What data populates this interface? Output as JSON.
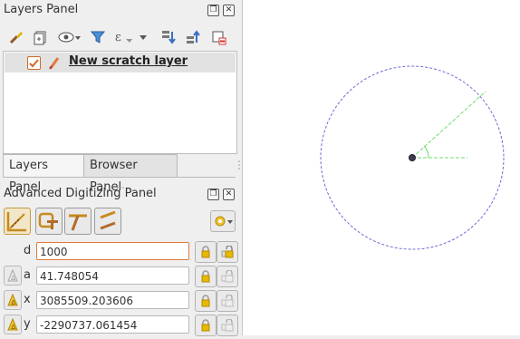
{
  "layers_panel": {
    "title": "Layers Panel",
    "float_icon": "float-icon",
    "close_icon": "close-icon",
    "toolbar": [
      {
        "name": "style-brush-icon"
      },
      {
        "name": "add-group-icon"
      },
      {
        "name": "eye-visibility-icon"
      },
      {
        "name": "filter-icon"
      },
      {
        "name": "expression-filter-icon"
      },
      {
        "name": "dropdown-arrow-icon"
      },
      {
        "name": "expand-all-icon"
      },
      {
        "name": "collapse-all-icon"
      },
      {
        "name": "remove-layer-icon"
      }
    ],
    "layers": [
      {
        "label": "New scratch layer",
        "checked": true,
        "icon": "edit-pencil-icon"
      }
    ]
  },
  "tabs": {
    "layers_panel_label": "Layers Panel",
    "browser_panel_label": "Browser Panel"
  },
  "advanced_digitizing": {
    "title": "Advanced Digitizing Panel",
    "tools": [
      {
        "name": "enable-advanced-digitizing-icon",
        "active": true
      },
      {
        "name": "construction-mode-icon",
        "active": false
      },
      {
        "name": "perpendicular-icon",
        "active": false
      },
      {
        "name": "parallel-icon",
        "active": false
      }
    ],
    "settings_icon": "gear-icon",
    "fields": {
      "d": {
        "label": "d",
        "value": "1000"
      },
      "a": {
        "label": "a",
        "value": "41.748054"
      },
      "x": {
        "label": "x",
        "value": "3085509.203606"
      },
      "y": {
        "label": "y",
        "value": "-2290737.061454"
      }
    }
  },
  "colors": {
    "circle": "#6b6bd6",
    "guide": "#6ddc6d",
    "point": "#3a3a5a",
    "focus_border": "#e07a3c"
  }
}
